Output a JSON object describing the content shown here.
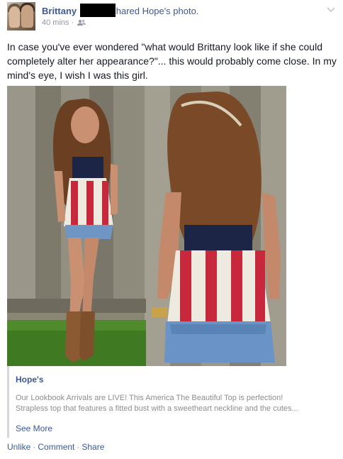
{
  "post": {
    "author": "Brittany",
    "action_text": "hared Hope's photo.",
    "timestamp": "40 mins",
    "meta_separator": "·",
    "privacy_icon": "friends-icon",
    "menu_icon": "chevron-down-icon",
    "text": "In case you've ever wondered \"what would Brittany look like if she could completely alter her appearance?\"... this would probably come close. In my mind's eye, I wish I was this girl."
  },
  "link_card": {
    "title": "Hope's",
    "description_line1": "Our Lookbook Arrivals are LIVE! This America The Beautiful Top is perfection!",
    "description_line2": "Strapless top that features a fitted bust with a sweetheart neckline and the cutes...",
    "see_more": "See More"
  },
  "actions": {
    "unlike": "Unlike",
    "comment": "Comment",
    "share": "Share",
    "separator": "·"
  },
  "colors": {
    "link_blue": "#3b5998",
    "meta_gray": "#9197a3",
    "text_dark": "#141823"
  }
}
